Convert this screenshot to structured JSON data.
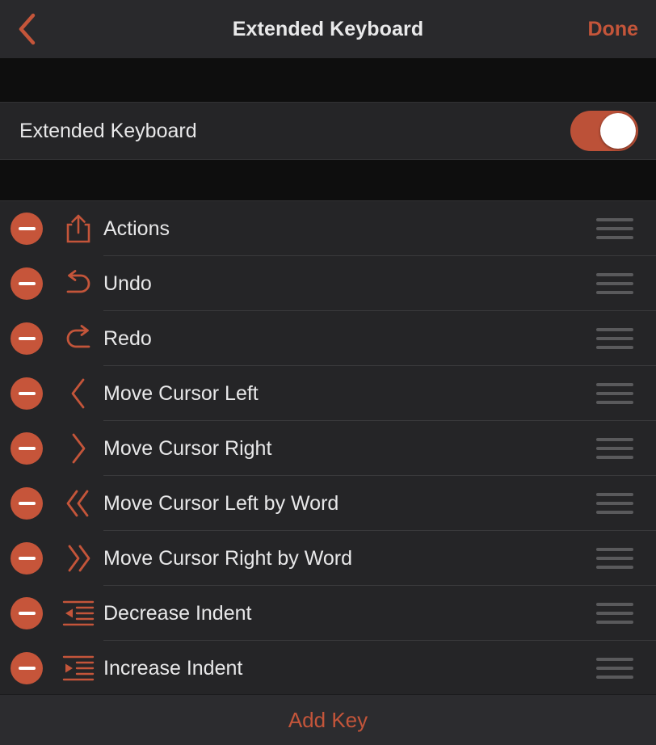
{
  "navbar": {
    "back_icon": "chevron-left-icon",
    "title": "Extended Keyboard",
    "done_label": "Done"
  },
  "toggle_section": {
    "label": "Extended Keyboard",
    "enabled": true,
    "state_text": "on"
  },
  "keys": {
    "remove_icon": "minus-circle-icon",
    "reorder_icon": "reorder-handle-icon",
    "rows": [
      {
        "label": "Actions",
        "icon": "share-icon"
      },
      {
        "label": "Undo",
        "icon": "undo-arrow-icon"
      },
      {
        "label": "Redo",
        "icon": "redo-arrow-icon"
      },
      {
        "label": "Move Cursor Left",
        "icon": "chevron-left-icon"
      },
      {
        "label": "Move Cursor Right",
        "icon": "chevron-right-icon"
      },
      {
        "label": "Move Cursor Left by Word",
        "icon": "double-chevron-left-icon"
      },
      {
        "label": "Move Cursor Right by Word",
        "icon": "double-chevron-right-icon"
      },
      {
        "label": "Decrease Indent",
        "icon": "decrease-indent-icon"
      },
      {
        "label": "Increase Indent",
        "icon": "increase-indent-icon"
      }
    ]
  },
  "footer": {
    "add_key_label": "Add Key"
  },
  "colors": {
    "accent": "#c4553a",
    "toggle_on": "#bc5138",
    "remove": "#c6553a",
    "row_background": "#252527",
    "page_background": "#0e0e0e",
    "navbar_background": "#29292c",
    "footer_background": "#2c2c2f",
    "text_primary": "#e8e8e9",
    "separator": "#3a3a3c",
    "grip": "#5a5a5c"
  }
}
